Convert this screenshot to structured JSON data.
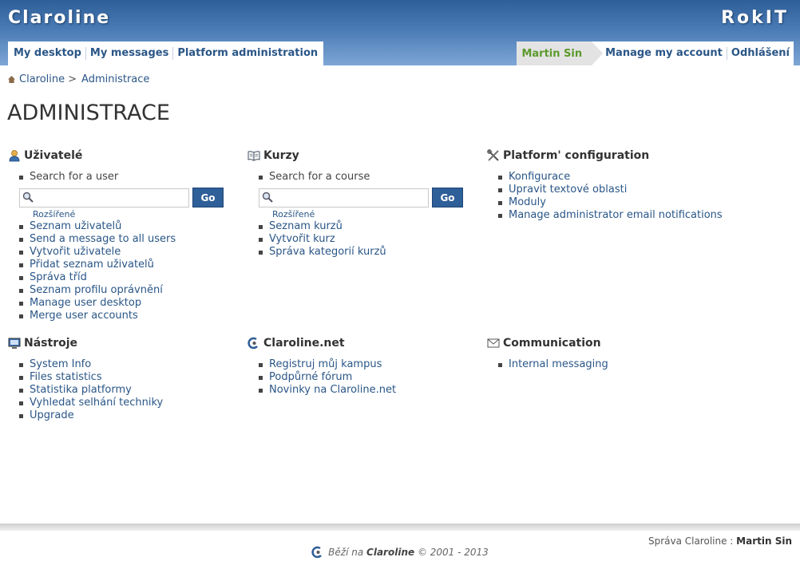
{
  "header": {
    "brand": "Claroline",
    "org": "RokIT",
    "nav": [
      "My desktop",
      "My messages",
      "Platform administration"
    ],
    "user": "Martin Sin",
    "account_link": "Manage my account",
    "logout_link": "Odhlášení"
  },
  "breadcrumb": {
    "home": "Claroline",
    "separator": ">",
    "current": "Administrace"
  },
  "page_title": "ADMINISTRACE",
  "sections": {
    "users": {
      "title": "Uživatelé",
      "search_label": "Search for a user",
      "go_label": "Go",
      "advanced_label": "Rozšířené",
      "links": [
        "Seznam uživatelů",
        "Send a message to all users",
        "Vytvořit uživatele",
        "Přidat seznam uživatelů",
        "Správa tříd",
        "Seznam profilu oprávnění",
        "Manage user desktop",
        "Merge user accounts"
      ]
    },
    "courses": {
      "title": "Kurzy",
      "search_label": "Search for a course",
      "go_label": "Go",
      "advanced_label": "Rozšířené",
      "links": [
        "Seznam kurzů",
        "Vytvořit kurz",
        "Správa kategorií kurzů"
      ]
    },
    "platform": {
      "title": "Platform' configuration",
      "links": [
        "Konfigurace",
        "Upravit textové oblasti",
        "Moduly",
        "Manage administrator email notifications"
      ]
    },
    "tools": {
      "title": "Nástroje",
      "links": [
        "System Info",
        "Files statistics",
        "Statistika platformy",
        "Vyhledat selhání techniky",
        "Upgrade"
      ]
    },
    "claroline_net": {
      "title": "Claroline.net",
      "links": [
        "Registruj můj kampus",
        "Podpůrné fórum",
        "Novinky na Claroline.net"
      ]
    },
    "communication": {
      "title": "Communication",
      "links": [
        "Internal messaging"
      ]
    }
  },
  "footer": {
    "admin_label": "Správa Claroline :",
    "admin_name": "Martin Sin",
    "credit_prefix": "Běží na",
    "credit_brand": "Claroline",
    "credit_suffix": "© 2001 - 2013"
  },
  "colors": {
    "header_top": "#2f5f98",
    "link": "#2a5687",
    "user_green": "#5b9a2c",
    "button": "#2f5f98"
  }
}
